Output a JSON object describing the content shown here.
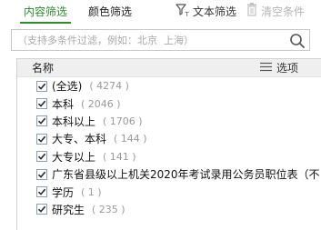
{
  "tabs": {
    "content_filter": "内容筛选",
    "color_filter": "颜色筛选"
  },
  "toolbar": {
    "text_filter": "文本筛选",
    "clear_conditions": "清空条件"
  },
  "search": {
    "placeholder": "（支持多条件过滤，例如：北京  上海）",
    "value": ""
  },
  "list": {
    "header_name": "名称",
    "header_options": "选项",
    "items": [
      {
        "label": "(全选)",
        "count": "( 4274 )",
        "checked": true
      },
      {
        "label": "本科",
        "count": "( 2046 )",
        "checked": true
      },
      {
        "label": "本科以上",
        "count": "( 1706 )",
        "checked": true
      },
      {
        "label": "大专、本科",
        "count": "( 144 )",
        "checked": true
      },
      {
        "label": "大专以上",
        "count": "( 141 )",
        "checked": true
      },
      {
        "label": "广东省县级以上机关2020年考试录用公务员职位表（不",
        "count": "",
        "checked": true
      },
      {
        "label": "学历",
        "count": "( 1 )",
        "checked": true
      },
      {
        "label": "研究生",
        "count": "( 235 )",
        "checked": true
      }
    ]
  },
  "colors": {
    "accent": "#2e8b2e",
    "checkbox_border": "#8aa0b8",
    "checkmark": "#2b2b2b"
  },
  "icons": {
    "text_filter": "funnel-t-icon",
    "clear": "trash-icon",
    "search": "magnifier-icon",
    "options": "list-options-icon"
  }
}
